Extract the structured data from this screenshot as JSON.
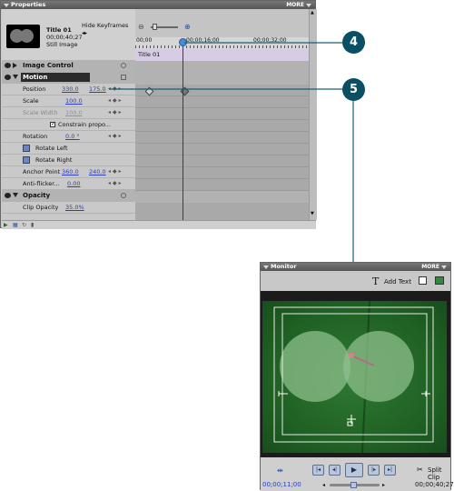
{
  "properties": {
    "title": "Properties",
    "more": "MORE",
    "hide_keyframes": "Hide Keyframes",
    "clip": {
      "name": "Title 01",
      "duration": "00;00;40;27",
      "type": "Still Image"
    },
    "ruler": {
      "t0": "00;00",
      "t1": "00;00;16;00",
      "t2": "00;00;32;00"
    },
    "clip_track": "Title 01",
    "sections": {
      "image_control": "Image Control",
      "motion": "Motion",
      "opacity": "Opacity"
    },
    "rows": {
      "position": {
        "label": "Position",
        "x": "330.0",
        "y": "175.0"
      },
      "scale": {
        "label": "Scale",
        "value": "100.0"
      },
      "scale_width": {
        "label": "Scale Width",
        "value": "100.0"
      },
      "constrain": {
        "label": "Constrain propo..."
      },
      "rotation": {
        "label": "Rotation",
        "value": "0.0 °"
      },
      "rotate_left": "Rotate Left",
      "rotate_right": "Rotate Right",
      "anchor": {
        "label": "Anchor Point",
        "x": "360.0",
        "y": "240.0"
      },
      "antiflicker": {
        "label": "Anti-flicker...",
        "value": "0.00"
      },
      "clip_opacity": {
        "label": "Clip Opacity",
        "value": "35.0%"
      }
    }
  },
  "monitor": {
    "title": "Monitor",
    "more": "MORE",
    "add_text": "Add Text",
    "timecode_left": "00;00;11;00",
    "timecode_right": "00;00;40;27",
    "split_clip": "Split Clip"
  },
  "callouts": {
    "c4": "4",
    "c5": "5"
  },
  "colors": {
    "callout": "#0a4f63",
    "cti": "#cc0000",
    "monitor_bg": "#2a6f2e"
  }
}
